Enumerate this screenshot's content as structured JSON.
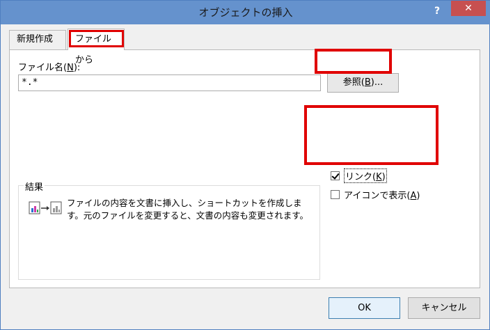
{
  "window": {
    "title": "オブジェクトの挿入",
    "help_label": "?",
    "close_label": "✕"
  },
  "tabs": [
    {
      "label": "新規作成",
      "selected": false
    },
    {
      "label": "ファイルから",
      "selected": true
    }
  ],
  "file": {
    "name_label_prefix": "ファイル名(",
    "name_label_key": "N",
    "name_label_suffix": "):",
    "name_value": "*.*"
  },
  "browse": {
    "label_prefix": "参照(",
    "label_key": "B",
    "label_suffix": ")..."
  },
  "options": {
    "link": {
      "label_prefix": "リンク(",
      "label_key": "K",
      "label_suffix": ")",
      "checked": true
    },
    "show_as_icon": {
      "label_prefix": "アイコンで表示(",
      "label_key": "A",
      "label_suffix": ")",
      "checked": false
    }
  },
  "result": {
    "title": "結果",
    "text": "ファイルの内容を文書に挿入し、ショートカットを作成します。元のファイルを変更すると、文書の内容も変更されます。"
  },
  "buttons": {
    "ok_label": "OK",
    "cancel_label": "キャンセル"
  },
  "colors": {
    "highlight": "#e00000",
    "titlebar": "#6592cd",
    "close": "#c75050"
  }
}
